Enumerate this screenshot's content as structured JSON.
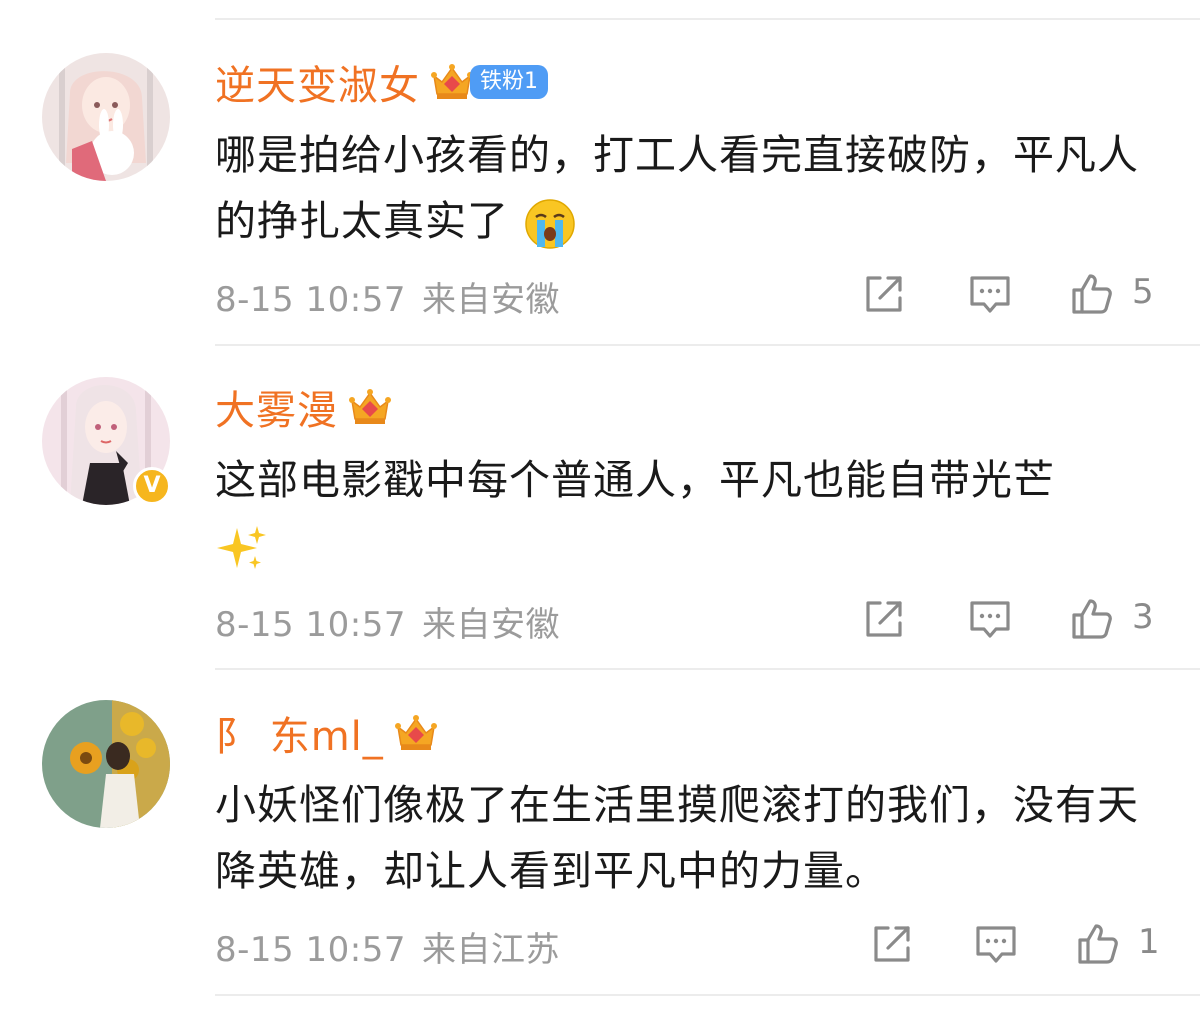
{
  "comments": [
    {
      "username": "逆天变淑女",
      "crown_level": "6",
      "fan_badge": "铁粉1",
      "text": "哪是拍给小孩看的，打工人看完直接破防，平凡人的挣扎太真实了",
      "emoji": "crying-face-emoji",
      "time": "8-15 10:57",
      "location": "来自安徽",
      "likes": "5"
    },
    {
      "username": "大雾漫",
      "crown_level": "5",
      "verified_mark": "V",
      "text": "这部电影戳中每个普通人，平凡也能自带光芒",
      "emoji": "sparkles-emoji",
      "time": "8-15 10:57",
      "location": "来自安徽",
      "likes": "3"
    },
    {
      "username": "阝 东ml_",
      "crown_level": "2",
      "text": "小妖怪们像极了在生活里摸爬滚打的我们，没有天降英雄，却让人看到平凡中的力量。",
      "time": "8-15 10:57",
      "location": "来自江苏",
      "likes": "1"
    }
  ],
  "colors": {
    "username": "#f07223",
    "fan_badge": "#4f9cf5",
    "meta": "#9b9b9b",
    "divider": "#ececec"
  },
  "icons": [
    "share-icon",
    "comment-icon",
    "like-icon",
    "crown-badge-icon",
    "verified-icon"
  ]
}
